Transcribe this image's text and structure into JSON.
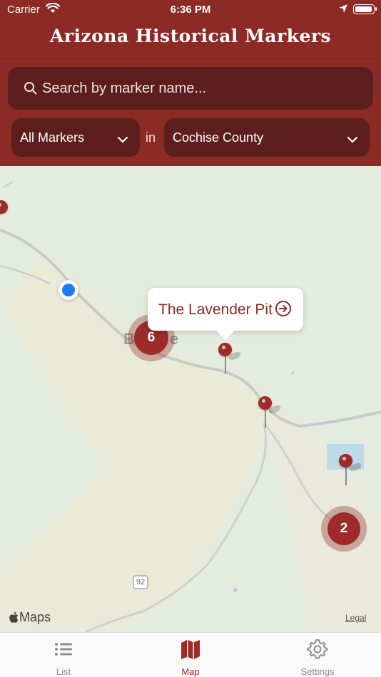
{
  "status_bar": {
    "carrier": "Carrier",
    "time": "6:36 PM"
  },
  "header": {
    "title": "Arizona Historical Markers",
    "color": "#8c2a26"
  },
  "search": {
    "placeholder": "Search by marker name...",
    "icon": "search-icon"
  },
  "filters": {
    "marker_type": "All Markers",
    "connector": "in",
    "county": "Cochise County"
  },
  "map": {
    "town_label": "Bisbee",
    "clusters": [
      {
        "count": "6"
      },
      {
        "count": "2"
      }
    ],
    "highway_shield": "92",
    "callout": {
      "title": "The Lavender Pit",
      "icon": "info-arrow-icon"
    },
    "attribution": "Maps",
    "legal": "Legal"
  },
  "tabbar": {
    "tabs": [
      {
        "label": "List",
        "icon": "list-icon"
      },
      {
        "label": "Map",
        "icon": "map-icon",
        "selected": true
      },
      {
        "label": "Settings",
        "icon": "gear-icon"
      }
    ],
    "accent": "#9c2b29"
  }
}
